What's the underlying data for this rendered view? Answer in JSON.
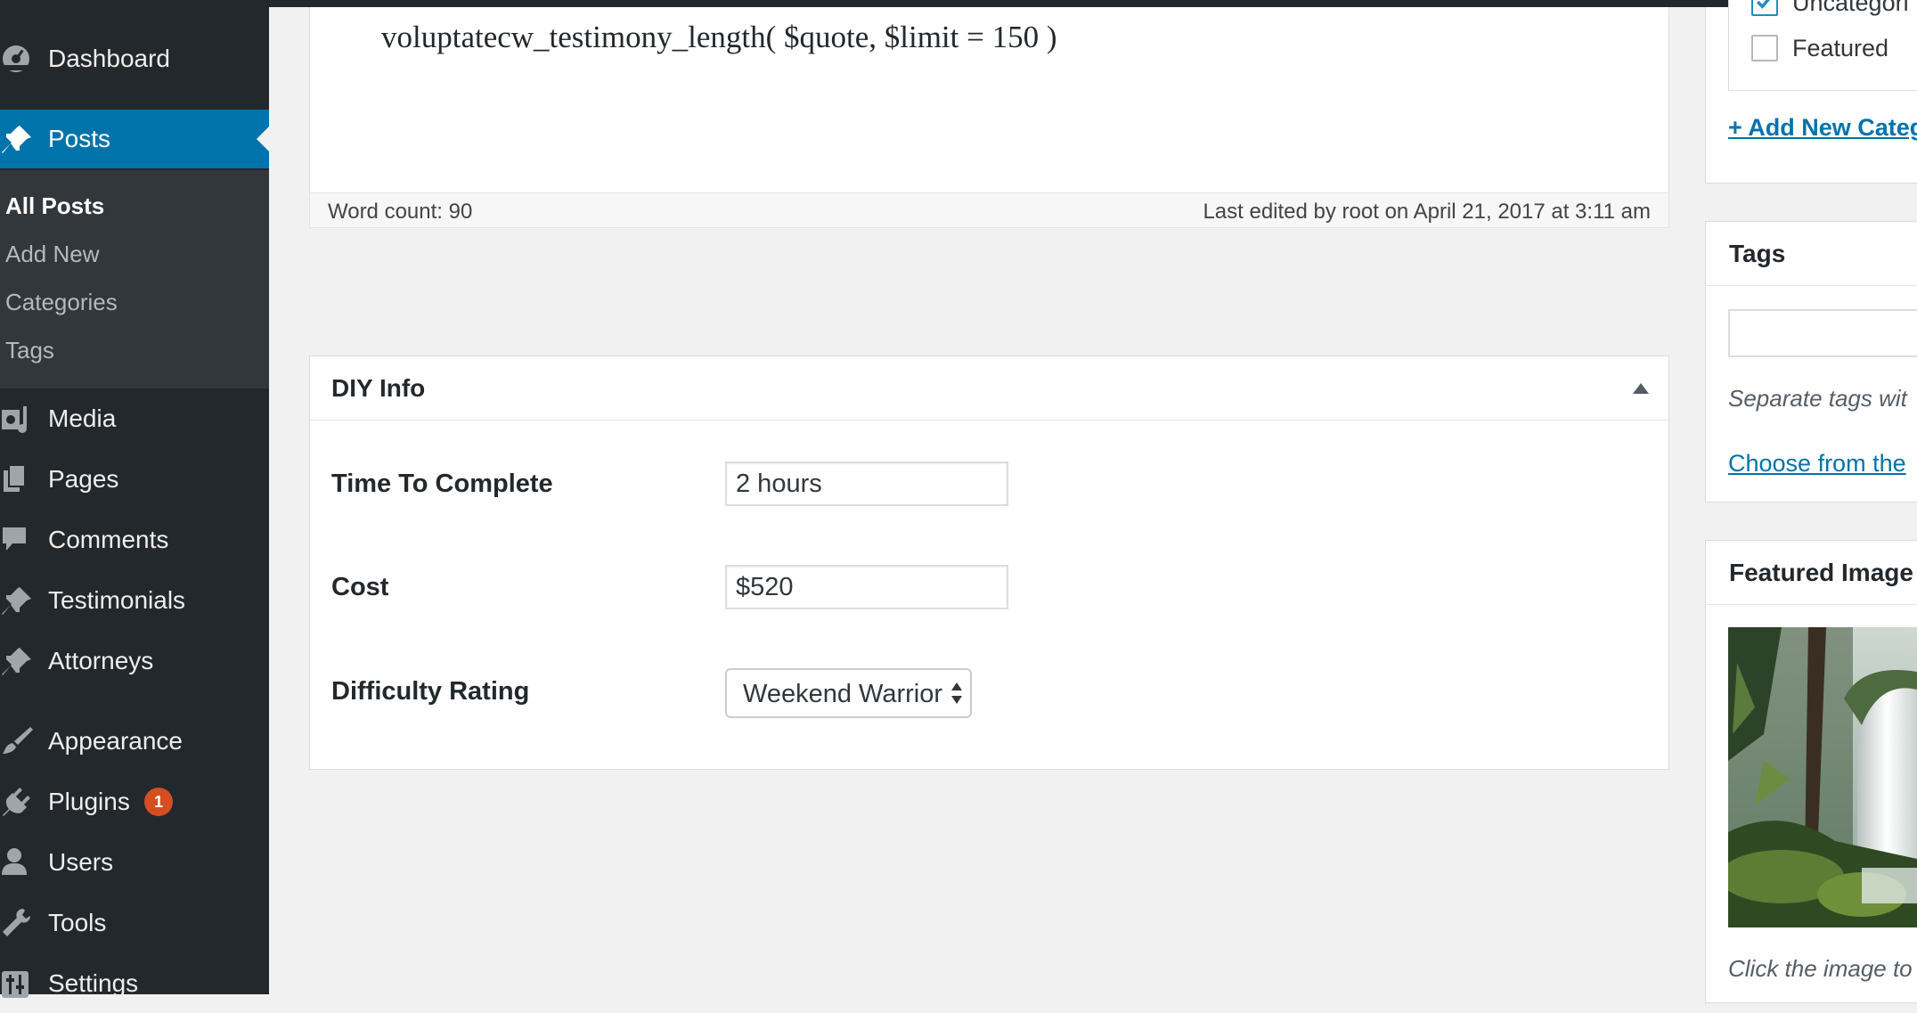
{
  "sidebar": {
    "items": [
      {
        "key": "dashboard",
        "label": "Dashboard",
        "icon": "dashboard-icon"
      },
      {
        "key": "posts",
        "label": "Posts",
        "icon": "pin-icon"
      },
      {
        "key": "media",
        "label": "Media",
        "icon": "media-icon"
      },
      {
        "key": "pages",
        "label": "Pages",
        "icon": "pages-icon"
      },
      {
        "key": "comments",
        "label": "Comments",
        "icon": "comment-icon"
      },
      {
        "key": "testimonials",
        "label": "Testimonials",
        "icon": "pin-icon"
      },
      {
        "key": "attorneys",
        "label": "Attorneys",
        "icon": "pin-icon"
      },
      {
        "key": "appearance",
        "label": "Appearance",
        "icon": "brush-icon"
      },
      {
        "key": "plugins",
        "label": "Plugins",
        "icon": "plugin-icon",
        "badge": "1"
      },
      {
        "key": "users",
        "label": "Users",
        "icon": "user-icon"
      },
      {
        "key": "tools",
        "label": "Tools",
        "icon": "wrench-icon"
      },
      {
        "key": "settings",
        "label": "Settings",
        "icon": "sliders-icon"
      }
    ],
    "posts_submenu": [
      "All Posts",
      "Add New",
      "Categories",
      "Tags"
    ],
    "active_item": "Posts",
    "current_submenu": "All Posts"
  },
  "editor": {
    "code_line": "voluptatecw_testimony_length( $quote, $limit = 150 )",
    "word_count": "Word count: 90",
    "last_edited": "Last edited by root on April 21, 2017 at 3:11 am"
  },
  "diy_box": {
    "title": "DIY Info",
    "fields": {
      "time_label": "Time To Complete",
      "time_value": "2 hours",
      "cost_label": "Cost",
      "cost_value": "$520",
      "difficulty_label": "Difficulty Rating",
      "difficulty_value": "Weekend Warrior"
    }
  },
  "categories": {
    "items": [
      {
        "label": "Uncategori",
        "checked": true
      },
      {
        "label": "Featured",
        "checked": false
      }
    ],
    "add_new": "+ Add New Categ"
  },
  "tags_box": {
    "title": "Tags",
    "hint": "Separate tags wit",
    "choose_link": "Choose from the "
  },
  "featured_image": {
    "title": "Featured Image",
    "hint": "Click the image to"
  },
  "colors": {
    "sidebar_bg": "#23282d",
    "submenu_bg": "#32373c",
    "active_blue": "#0073aa",
    "badge_orange": "#d54e21",
    "page_bg": "#f1f1f1"
  }
}
